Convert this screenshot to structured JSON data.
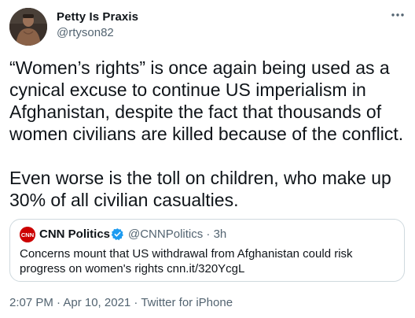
{
  "author": {
    "display_name": "Petty Is Praxis",
    "handle": "@rtyson82"
  },
  "icons": {
    "more": "more-options-icon",
    "verified": "verified-badge-icon",
    "cnn_logo": "cnn-logo-icon"
  },
  "tweet": {
    "text": "“Women’s rights” is once again being used as a cynical excuse to continue US imperialism in Afghanistan, despite the fact that thousands of women civilians are killed because of the conflict.\n\nEven worse is the toll on children, who make up 30% of all civilian casualties."
  },
  "quote": {
    "name": "CNN Politics",
    "meta": "@CNNPolitics · 3h",
    "logo_text": "CNN",
    "text": "Concerns mount that US withdrawal from Afghanistan could risk progress on women's rights cnn.it/320YcgL"
  },
  "footer": {
    "timestamp": "2:07 PM · Apr 10, 2021 · Twitter for iPhone"
  },
  "colors": {
    "text": "#0f1419",
    "secondary": "#536471",
    "border": "#cfd9de",
    "verified": "#1d9bf0",
    "cnn_red": "#cc0000"
  }
}
